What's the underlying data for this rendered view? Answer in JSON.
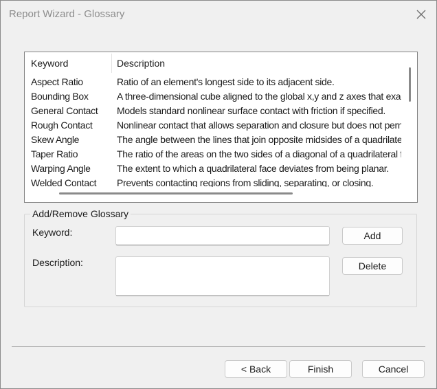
{
  "window": {
    "title": "Report Wizard - Glossary"
  },
  "glossary_list": {
    "headers": {
      "keyword": "Keyword",
      "description": "Description"
    },
    "rows": [
      {
        "keyword": "Aspect Ratio",
        "description": "Ratio of an element's longest side to its adjacent side."
      },
      {
        "keyword": "Bounding Box",
        "description": "A three-dimensional cube aligned to the global x,y and z axes that exac"
      },
      {
        "keyword": "General Contact",
        "description": "Models standard nonlinear surface contact with friction if specified."
      },
      {
        "keyword": "Rough Contact",
        "description": "Nonlinear contact that allows separation and closure but does not pern"
      },
      {
        "keyword": "Skew Angle",
        "description": "The angle between the lines that join opposite midsides of a quadrilater"
      },
      {
        "keyword": "Taper Ratio",
        "description": "The ratio of the areas on the two sides of a diagonal of a quadrilateral f"
      },
      {
        "keyword": "Warping Angle",
        "description": "The extent to which a quadrilateral face deviates from being planar."
      },
      {
        "keyword": "Welded Contact",
        "description": "Prevents contacting regions from sliding, separating, or closing."
      }
    ]
  },
  "add_remove": {
    "group_label": "Add/Remove Glossary",
    "keyword_label": "Keyword:",
    "keyword_value": "",
    "description_label": "Description:",
    "description_value": "",
    "add_label": "Add",
    "delete_label": "Delete"
  },
  "footer": {
    "back_label": "< Back",
    "finish_label": "Finish",
    "cancel_label": "Cancel"
  }
}
